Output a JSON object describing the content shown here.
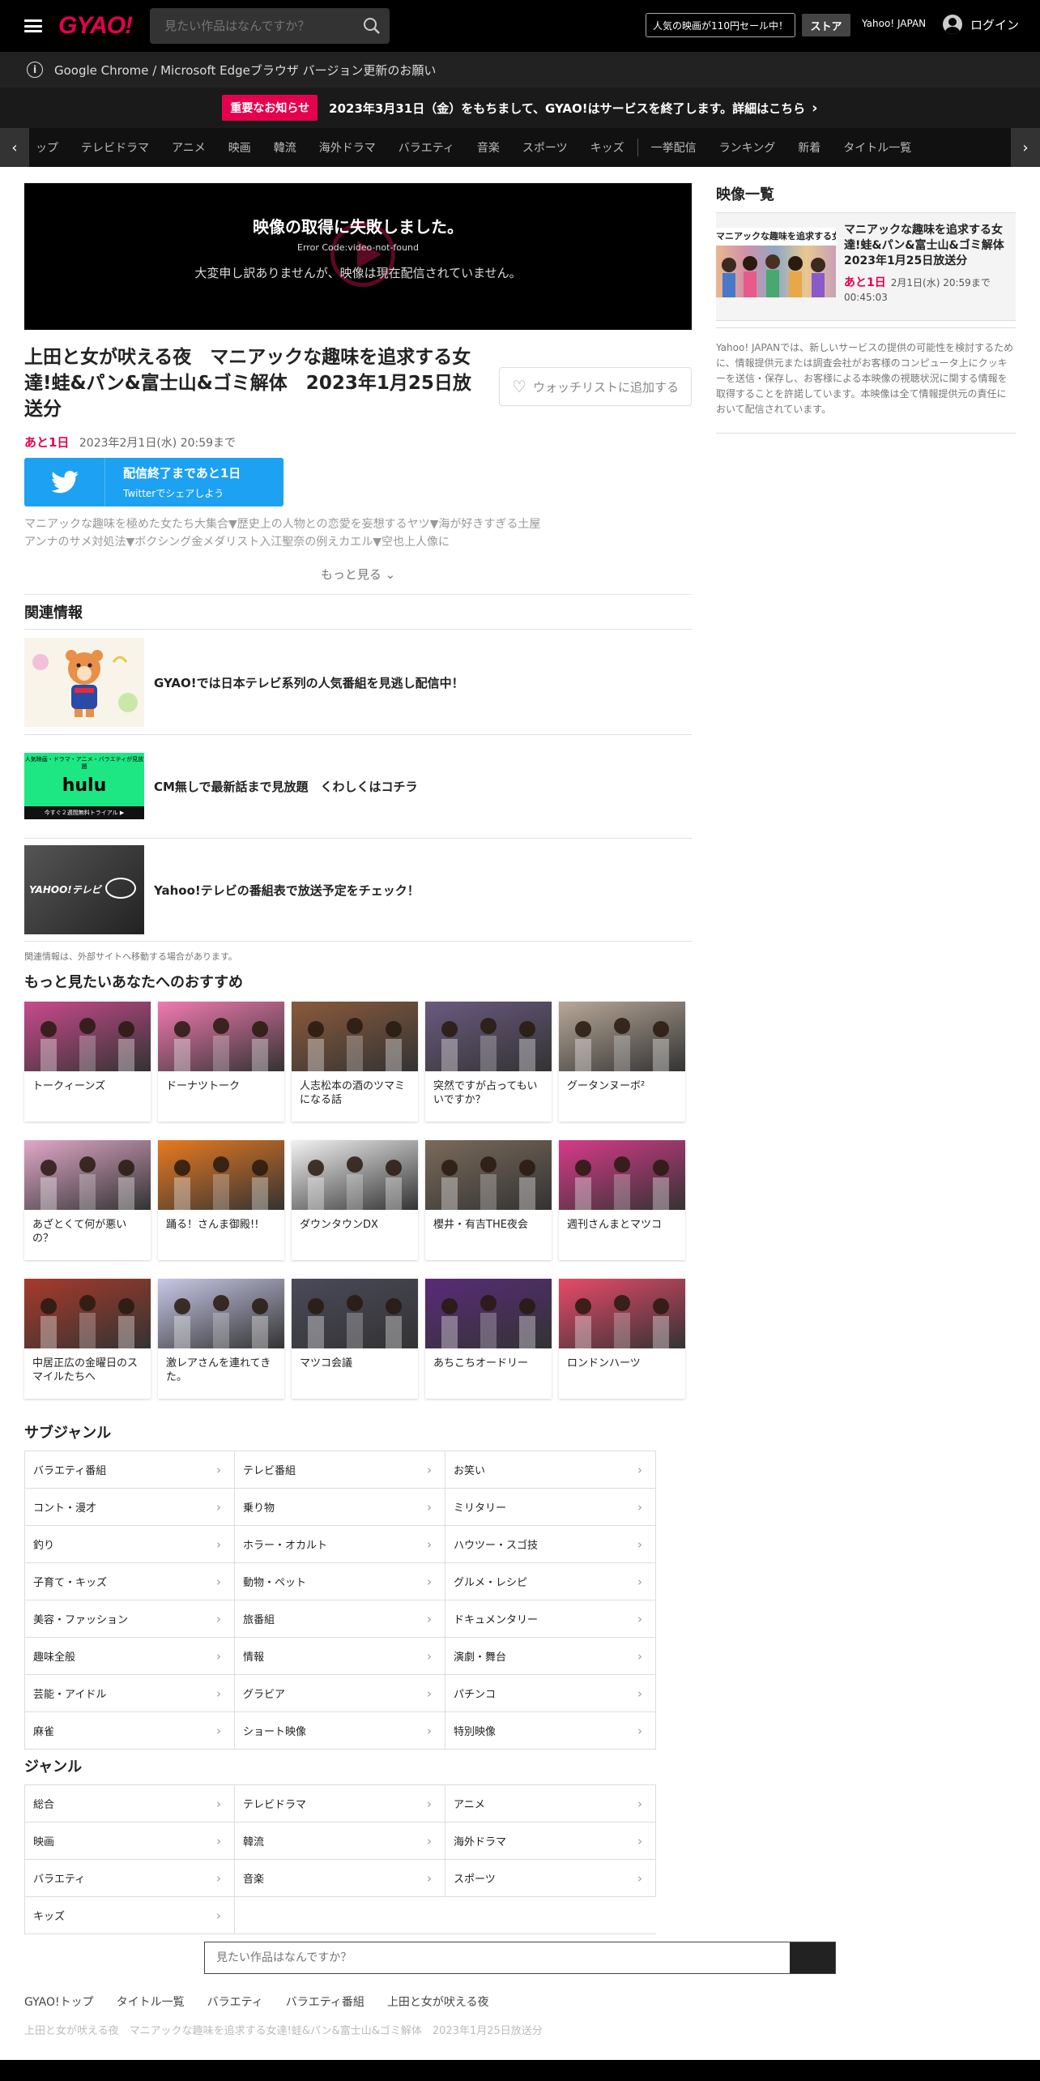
{
  "header": {
    "logo": "GYAO!",
    "search_placeholder": "見たい作品はなんですか？",
    "promo": "人気の映画が110円セール中！",
    "store": "ストア",
    "yahoo_link": "Yahoo! JAPAN",
    "login": "ログイン"
  },
  "browser_notice": "Google Chrome / Microsoft Edgeブラウザ バージョン更新のお願い",
  "announcement": {
    "badge": "重要なお知らせ",
    "text": "2023年3月31日（金）をもちまして、GYAO!はサービスを終了します。詳細はこちら"
  },
  "nav": {
    "items": [
      "ップ",
      "テレビドラマ",
      "アニメ",
      "映画",
      "韓流",
      "海外ドラマ",
      "バラエティ",
      "音楽",
      "スポーツ",
      "キッズ"
    ],
    "items_after_sep": [
      "一挙配信",
      "ランキング",
      "新着",
      "タイトル一覧"
    ]
  },
  "player": {
    "error_title": "映像の取得に失敗しました。",
    "error_code": "Error Code:video-not-found",
    "error_message": "大変申し訳ありませんが、映像は現在配信されていません。"
  },
  "episode": {
    "title": "上田と女が吠える夜　マニアックな趣味を追求する女達!蛙&パン&富士山&ゴミ解体　2023年1月25日放送分",
    "remaining": "あと1日",
    "deadline": "2023年2月1日(水) 20:59まで",
    "watchlist": "ウォッチリストに追加する",
    "twitter_main": "配信終了まであと1日",
    "twitter_sub": "Twitterでシェアしよう",
    "description": "マニアックな趣味を極めた女たち大集合▼歴史上の人物との恋愛を妄想するヤツ▼海が好きすぎる土屋アンナのサメ対処法▼ボクシング金メダリスト入江聖奈の例えカエル▼空也上人像に",
    "more": "もっと見る"
  },
  "related": {
    "title": "関連情報",
    "items": [
      {
        "text": "GYAO!では日本テレビ系列の人気番組を見逃し配信中！"
      },
      {
        "text": "CM無しで最新話まで見放題　くわしくはコチラ",
        "thumb_top": "人気映画・ドラマ・アニメ・バラエティが見放題",
        "thumb_logo": "hulu",
        "thumb_bottom": "今すぐ２週間無料トライアル ▶"
      },
      {
        "text": "Yahoo!テレビの番組表で放送予定をチェック！",
        "thumb_logo": "YAHOO!テレビ"
      }
    ],
    "note": "関連情報は、外部サイトへ移動する場合があります。"
  },
  "recommend": {
    "title": "もっと見たいあなたへのおすすめ",
    "items": [
      {
        "name": "トークィーンズ",
        "color": "#c94a8c"
      },
      {
        "name": "ドーナツトーク",
        "color": "#f27ab0"
      },
      {
        "name": "人志松本の酒のツマミになる話",
        "color": "#8a5a3c"
      },
      {
        "name": "突然ですが占ってもいいですか？",
        "color": "#6a5a80"
      },
      {
        "name": "グータンヌーボ²",
        "color": "#b8a898"
      },
      {
        "name": "あざとくて何が悪いの？",
        "color": "#e0a8c8"
      },
      {
        "name": "踊る！さんま御殿!!",
        "color": "#e87a20"
      },
      {
        "name": "ダウンタウンDX",
        "color": "#f2f2f2"
      },
      {
        "name": "櫻井・有吉THE夜会",
        "color": "#7a6a5a"
      },
      {
        "name": "週刊さんまとマツコ",
        "color": "#d83a8a"
      },
      {
        "name": "中居正広の金曜日のスマイルたちへ",
        "color": "#a83a2a"
      },
      {
        "name": "激レアさんを連れてきた。",
        "color": "#c8c8e8"
      },
      {
        "name": "マツコ会議",
        "color": "#4a4a5a"
      },
      {
        "name": "あちこちオードリー",
        "color": "#5a2a7a"
      },
      {
        "name": "ロンドンハーツ",
        "color": "#e84a6a"
      }
    ]
  },
  "subgenre": {
    "title": "サブジャンル",
    "items": [
      "バラエティ番組",
      "テレビ番組",
      "お笑い",
      "コント・漫才",
      "乗り物",
      "ミリタリー",
      "釣り",
      "ホラー・オカルト",
      "ハウツー・スゴ技",
      "子育て・キッズ",
      "動物・ペット",
      "グルメ・レシピ",
      "美容・ファッション",
      "旅番組",
      "ドキュメンタリー",
      "趣味全般",
      "情報",
      "演劇・舞台",
      "芸能・アイドル",
      "グラビア",
      "パチンコ",
      "麻雀",
      "ショート映像",
      "特別映像"
    ]
  },
  "genre": {
    "title": "ジャンル",
    "items": [
      "総合",
      "テレビドラマ",
      "アニメ",
      "映画",
      "韓流",
      "海外ドラマ",
      "バラエティ",
      "音楽",
      "スポーツ",
      "キッズ"
    ]
  },
  "bottom_search_placeholder": "見たい作品はなんですか？",
  "breadcrumb": [
    "GYAO!トップ",
    "タイトル一覧",
    "バラエティ",
    "バラエティ番組",
    "上田と女が吠える夜"
  ],
  "breadcrumb_current": "上田と女が吠える夜　マニアックな趣味を追求する女達!蛙&パン&富士山&ゴミ解体　2023年1月25日放送分",
  "sidebar": {
    "title": "映像一覧",
    "item_title": "マニアックな趣味を追求する女達!蛙&パン&富士山&ゴミ解体　2023年1月25日放送分",
    "item_remaining": "あと1日",
    "item_deadline": "2月1日(水) 20:59まで",
    "item_duration": "00:45:03",
    "thumb_caption": "マニアックな趣味を追求する女",
    "note": "Yahoo! JAPANでは、新しいサービスの提供の可能性を検討するために、情報提供元または調査会社がお客様のコンピュータ上にクッキーを送信・保存し、お客様による本映像の視聴状況に関する情報を取得することを許諾しています。本映像は全て情報提供元の責任において配信されています。"
  },
  "colors": {
    "brand": "#e5004f",
    "twitter": "#1da1f2"
  }
}
